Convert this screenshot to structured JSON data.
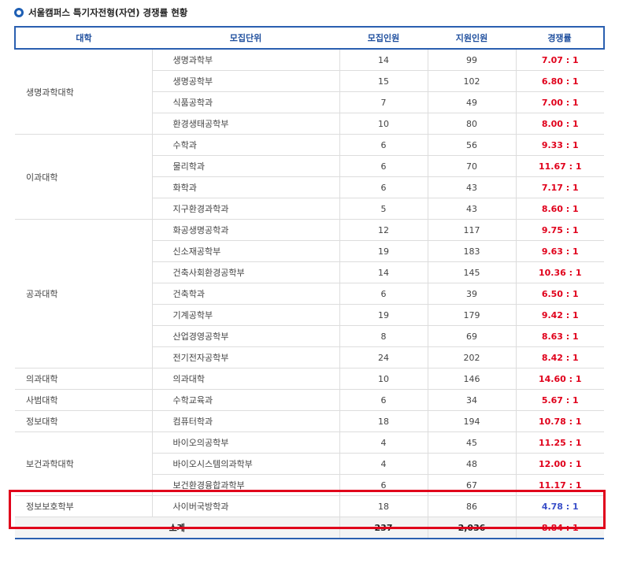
{
  "title": "서울캠퍼스 특기자전형(자연) 경쟁률 현황",
  "headers": [
    "대학",
    "모집단위",
    "모집인원",
    "지원인원",
    "경쟁률"
  ],
  "groups": [
    {
      "college": "생명과학대학",
      "rows": [
        {
          "unit": "생명과학부",
          "quota": "14",
          "applicants": "99",
          "ratio": "7.07 : 1"
        },
        {
          "unit": "생명공학부",
          "quota": "15",
          "applicants": "102",
          "ratio": "6.80 : 1"
        },
        {
          "unit": "식품공학과",
          "quota": "7",
          "applicants": "49",
          "ratio": "7.00 : 1"
        },
        {
          "unit": "환경생태공학부",
          "quota": "10",
          "applicants": "80",
          "ratio": "8.00 : 1"
        }
      ]
    },
    {
      "college": "이과대학",
      "rows": [
        {
          "unit": "수학과",
          "quota": "6",
          "applicants": "56",
          "ratio": "9.33 : 1"
        },
        {
          "unit": "물리학과",
          "quota": "6",
          "applicants": "70",
          "ratio": "11.67 : 1"
        },
        {
          "unit": "화학과",
          "quota": "6",
          "applicants": "43",
          "ratio": "7.17 : 1"
        },
        {
          "unit": "지구환경과학과",
          "quota": "5",
          "applicants": "43",
          "ratio": "8.60 : 1"
        }
      ]
    },
    {
      "college": "공과대학",
      "rows": [
        {
          "unit": "화공생명공학과",
          "quota": "12",
          "applicants": "117",
          "ratio": "9.75 : 1"
        },
        {
          "unit": "신소재공학부",
          "quota": "19",
          "applicants": "183",
          "ratio": "9.63 : 1"
        },
        {
          "unit": "건축사회환경공학부",
          "quota": "14",
          "applicants": "145",
          "ratio": "10.36 : 1"
        },
        {
          "unit": "건축학과",
          "quota": "6",
          "applicants": "39",
          "ratio": "6.50 : 1"
        },
        {
          "unit": "기계공학부",
          "quota": "19",
          "applicants": "179",
          "ratio": "9.42 : 1"
        },
        {
          "unit": "산업경영공학부",
          "quota": "8",
          "applicants": "69",
          "ratio": "8.63 : 1"
        },
        {
          "unit": "전기전자공학부",
          "quota": "24",
          "applicants": "202",
          "ratio": "8.42 : 1"
        }
      ]
    },
    {
      "college": "의과대학",
      "rows": [
        {
          "unit": "의과대학",
          "quota": "10",
          "applicants": "146",
          "ratio": "14.60 : 1"
        }
      ]
    },
    {
      "college": "사범대학",
      "rows": [
        {
          "unit": "수학교육과",
          "quota": "6",
          "applicants": "34",
          "ratio": "5.67 : 1"
        }
      ]
    },
    {
      "college": "정보대학",
      "rows": [
        {
          "unit": "컴퓨터학과",
          "quota": "18",
          "applicants": "194",
          "ratio": "10.78 : 1"
        }
      ]
    },
    {
      "college": "보건과학대학",
      "rows": [
        {
          "unit": "바이오의공학부",
          "quota": "4",
          "applicants": "45",
          "ratio": "11.25 : 1"
        },
        {
          "unit": "바이오시스템의과학부",
          "quota": "4",
          "applicants": "48",
          "ratio": "12.00 : 1"
        },
        {
          "unit": "보건환경융합과학부",
          "quota": "6",
          "applicants": "67",
          "ratio": "11.17 : 1"
        }
      ]
    },
    {
      "college": "정보보호학부",
      "rows": [
        {
          "unit": "사이버국방학과",
          "quota": "18",
          "applicants": "86",
          "ratio": "4.78 : 1",
          "highlight": true
        }
      ]
    }
  ],
  "total": {
    "label": "소계",
    "quota": "237",
    "applicants": "2,036",
    "ratio": "8.84 : 1"
  },
  "colors": {
    "header_border": "#2a5fb0",
    "ratio_red": "#e0001b",
    "ratio_blue": "#3a4fc8",
    "highlight_box": "#e0001b"
  }
}
